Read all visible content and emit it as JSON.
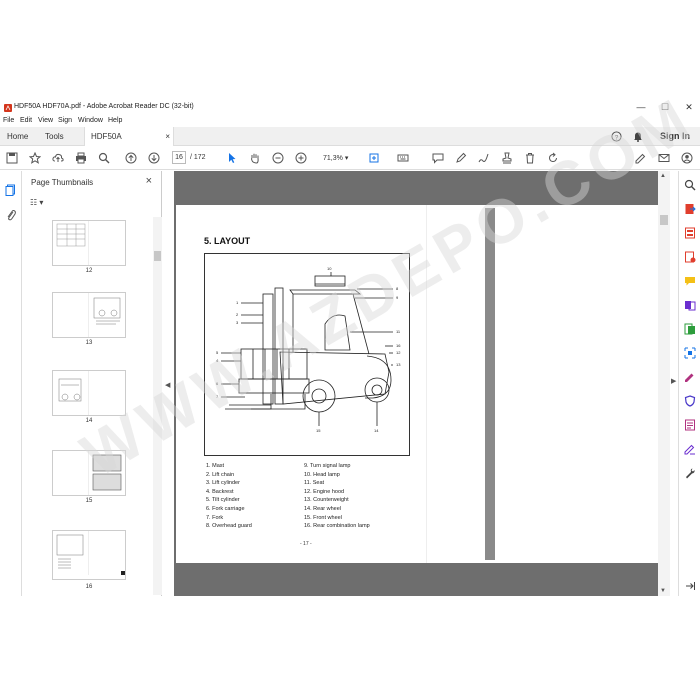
{
  "window": {
    "title": "HDF50A HDF70A.pdf - Adobe Acrobat Reader DC (32-bit)"
  },
  "menu": [
    "File",
    "Edit",
    "View",
    "Sign",
    "Window",
    "Help"
  ],
  "tabs": {
    "home": "Home",
    "tools": "Tools",
    "doc": "HDF50A HDF70A.p...",
    "close": "×"
  },
  "header": {
    "sign_in": "Sign In"
  },
  "toolbar": {
    "page_current": "16",
    "page_total": "/ 172",
    "zoom": "71,3%"
  },
  "thumbnails": {
    "title": "Page Thumbnails",
    "close": "×",
    "pages": [
      {
        "label": "12"
      },
      {
        "label": "13"
      },
      {
        "label": "14"
      },
      {
        "label": "15"
      },
      {
        "label": "16"
      }
    ]
  },
  "document": {
    "heading": "5. LAYOUT",
    "callouts": [
      "1",
      "2",
      "3",
      "4",
      "5",
      "6",
      "7",
      "8",
      "9",
      "10",
      "11",
      "12",
      "13",
      "14",
      "15",
      "16"
    ],
    "legend_left": [
      "1. Mast",
      "2. Lift chain",
      "3. Lift cylinder",
      "4. Backrest",
      "5. Tilt cylinder",
      "6. Fork carriage",
      "7. Fork",
      "8. Overhead guard"
    ],
    "legend_right": [
      "9. Turn signal lamp",
      "10. Head lamp",
      "11. Seat",
      "12. Engine hood",
      "13. Counterweight",
      "14. Rear wheel",
      "15. Front wheel",
      "16. Rear combination lamp"
    ],
    "page_number": "- 17 -"
  },
  "watermark": "WWW.AZDEPO.COM",
  "colors": {
    "accent": "#1473e6",
    "doc_bg": "#6e6e6e",
    "pdf_red": "#d4351c"
  }
}
